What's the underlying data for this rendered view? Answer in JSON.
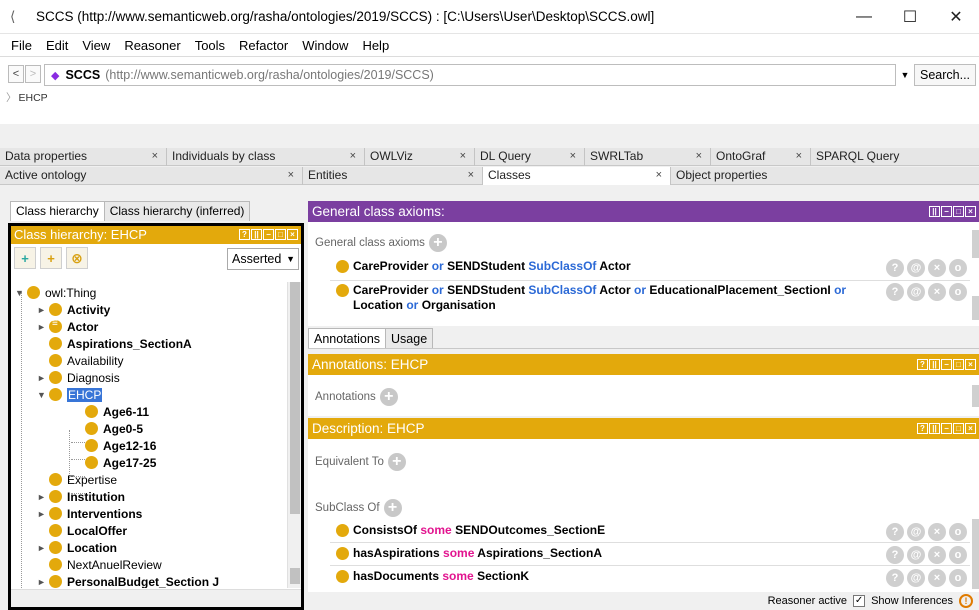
{
  "window": {
    "title": "SCCS (http://www.semanticweb.org/rasha/ontologies/2019/SCCS)  : [C:\\Users\\User\\Desktop\\SCCS.owl]",
    "minimize": "—",
    "maximize": "☐",
    "close": "✕"
  },
  "menu": [
    "File",
    "Edit",
    "View",
    "Reasoner",
    "Tools",
    "Refactor",
    "Window",
    "Help"
  ],
  "address": {
    "back": "<",
    "forward": ">",
    "ontology_name": "SCCS",
    "ontology_iri": "(http://www.semanticweb.org/rasha/ontologies/2019/SCCS)",
    "search_label": "Search...",
    "breadcrumb": "EHCP"
  },
  "tabs_row1": [
    {
      "label": "Data properties"
    },
    {
      "label": "Individuals by class"
    },
    {
      "label": "OWLViz"
    },
    {
      "label": "DL Query"
    },
    {
      "label": "SWRLTab"
    },
    {
      "label": "OntoGraf"
    },
    {
      "label": "SPARQL Query"
    }
  ],
  "tabs_row2": [
    {
      "label": "Active ontology"
    },
    {
      "label": "Entities"
    },
    {
      "label": "Classes"
    },
    {
      "label": "Object properties"
    }
  ],
  "left": {
    "subtabs": [
      "Class hierarchy",
      "Class hierarchy (inferred)"
    ],
    "header": "Class hierarchy: EHCP",
    "mode": "Asserted",
    "tree": [
      {
        "label": "owl:Thing"
      },
      {
        "label": "Activity"
      },
      {
        "label": "Actor"
      },
      {
        "label": "Aspirations_SectionA"
      },
      {
        "label": "Availability"
      },
      {
        "label": "Diagnosis"
      },
      {
        "label": "EHCP"
      },
      {
        "label": "Age6-11"
      },
      {
        "label": "Age0-5"
      },
      {
        "label": "Age12-16"
      },
      {
        "label": "Age17-25"
      },
      {
        "label": "Expertise"
      },
      {
        "label": "Institution"
      },
      {
        "label": "Interventions"
      },
      {
        "label": "LocalOffer"
      },
      {
        "label": "Location"
      },
      {
        "label": "NextAnuelReview"
      },
      {
        "label": "PersonalBudget_Section J"
      }
    ]
  },
  "right": {
    "gca_header": "General class axioms:",
    "gca_label": "General class axioms",
    "gca1": {
      "a": "CareProvider",
      "or": "or",
      "b": "SENDStudent",
      "sub": "SubClassOf",
      "c": "Actor"
    },
    "gca2": {
      "a": "CareProvider",
      "or1": "or",
      "b": "SENDStudent",
      "sub": "SubClassOf",
      "c": "Actor",
      "or2": "or",
      "d": "EducationalPlacement_SectionI",
      "or3": "or",
      "e": "Location",
      "or4": "or",
      "f": "Organisation"
    },
    "mid_tabs": [
      "Annotations",
      "Usage"
    ],
    "ann_header": "Annotations: EHCP",
    "ann_label": "Annotations",
    "desc_header": "Description: EHCP",
    "equiv_label": "Equivalent To",
    "subclass_label": "SubClass Of",
    "sc1": {
      "p": "ConsistsOf",
      "some": "some",
      "c": "SENDOutcomes_SectionE"
    },
    "sc2": {
      "p": "hasAspirations",
      "some": "some",
      "c": "Aspirations_SectionA"
    },
    "sc3": {
      "p": "hasDocuments",
      "some": "some",
      "c": "SectionK"
    }
  },
  "status": {
    "reasoner": "Reasoner active",
    "show_inferences": "Show Inferences"
  },
  "colors": {
    "class_gold": "#e3a90c",
    "gca_purple": "#7b3fa0",
    "keyword_blue": "#2b69d6",
    "restriction_pink": "#e2148f",
    "selection_blue": "#3875d7"
  }
}
